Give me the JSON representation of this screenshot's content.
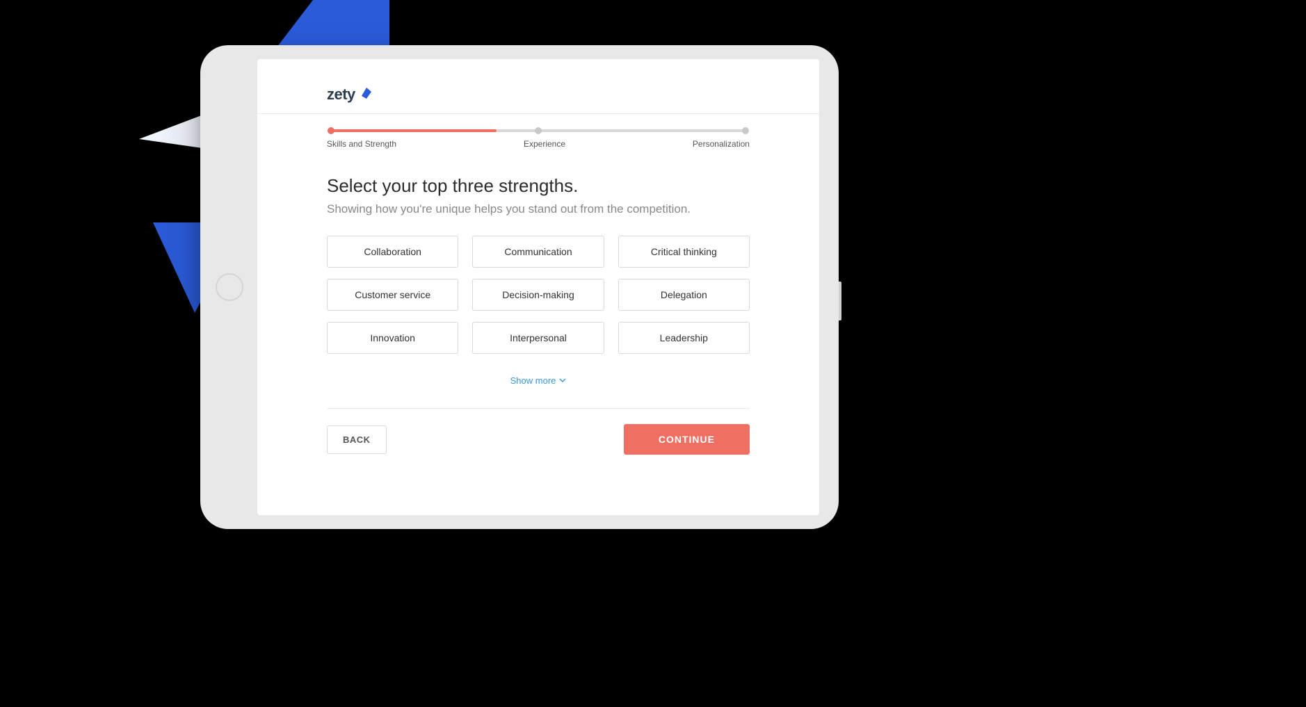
{
  "brand": {
    "name": "zety",
    "logo_color": "#2b5bd8"
  },
  "progress": {
    "steps": [
      {
        "label": "Skills and Strength",
        "active": true
      },
      {
        "label": "Experience",
        "active": false
      },
      {
        "label": "Personalization",
        "active": false
      }
    ],
    "fill_percent": 40
  },
  "page": {
    "title": "Select your top three strengths.",
    "subtitle": "Showing how you're unique helps you stand out from the competition."
  },
  "options": [
    "Collaboration",
    "Communication",
    "Critical thinking",
    "Customer service",
    "Decision-making",
    "Delegation",
    "Innovation",
    "Interpersonal",
    "Leadership"
  ],
  "show_more_label": "Show more",
  "footer": {
    "back_label": "BACK",
    "continue_label": "CONTINUE"
  },
  "colors": {
    "accent": "#ef6f63",
    "link": "#3498db"
  }
}
